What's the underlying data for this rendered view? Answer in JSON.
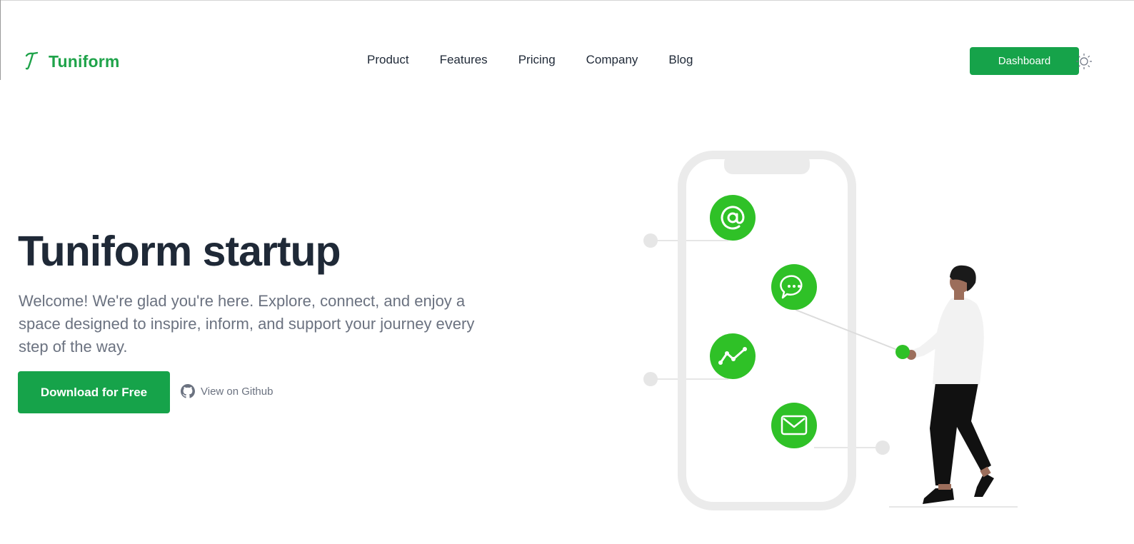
{
  "brand": {
    "name": "Tuniform",
    "logo_icon": "tuniform-logo-icon"
  },
  "nav": {
    "items": [
      {
        "label": "Product"
      },
      {
        "label": "Features"
      },
      {
        "label": "Pricing"
      },
      {
        "label": "Company"
      },
      {
        "label": "Blog"
      }
    ]
  },
  "header": {
    "dashboard_label": "Dashboard",
    "theme_icon": "sun-icon"
  },
  "hero": {
    "title": "Tuniform startup",
    "text": "Welcome! We're glad you're here. Explore, connect, and enjoy a space designed to inspire, inform, and support your journey every step of the way.",
    "primary_cta": "Download for Free",
    "secondary_cta": "View on Github",
    "secondary_icon": "github-icon"
  },
  "illustration": {
    "icons": [
      "at-sign-icon",
      "chat-bubble-icon",
      "trend-chart-icon",
      "mail-icon"
    ]
  },
  "colors": {
    "accent": "#16a34a",
    "brand_text": "#1fa34a",
    "heading": "#1f2937",
    "body_text": "#6b7280",
    "illustration_green": "#2fc127",
    "illustration_gray": "#ebebeb"
  }
}
